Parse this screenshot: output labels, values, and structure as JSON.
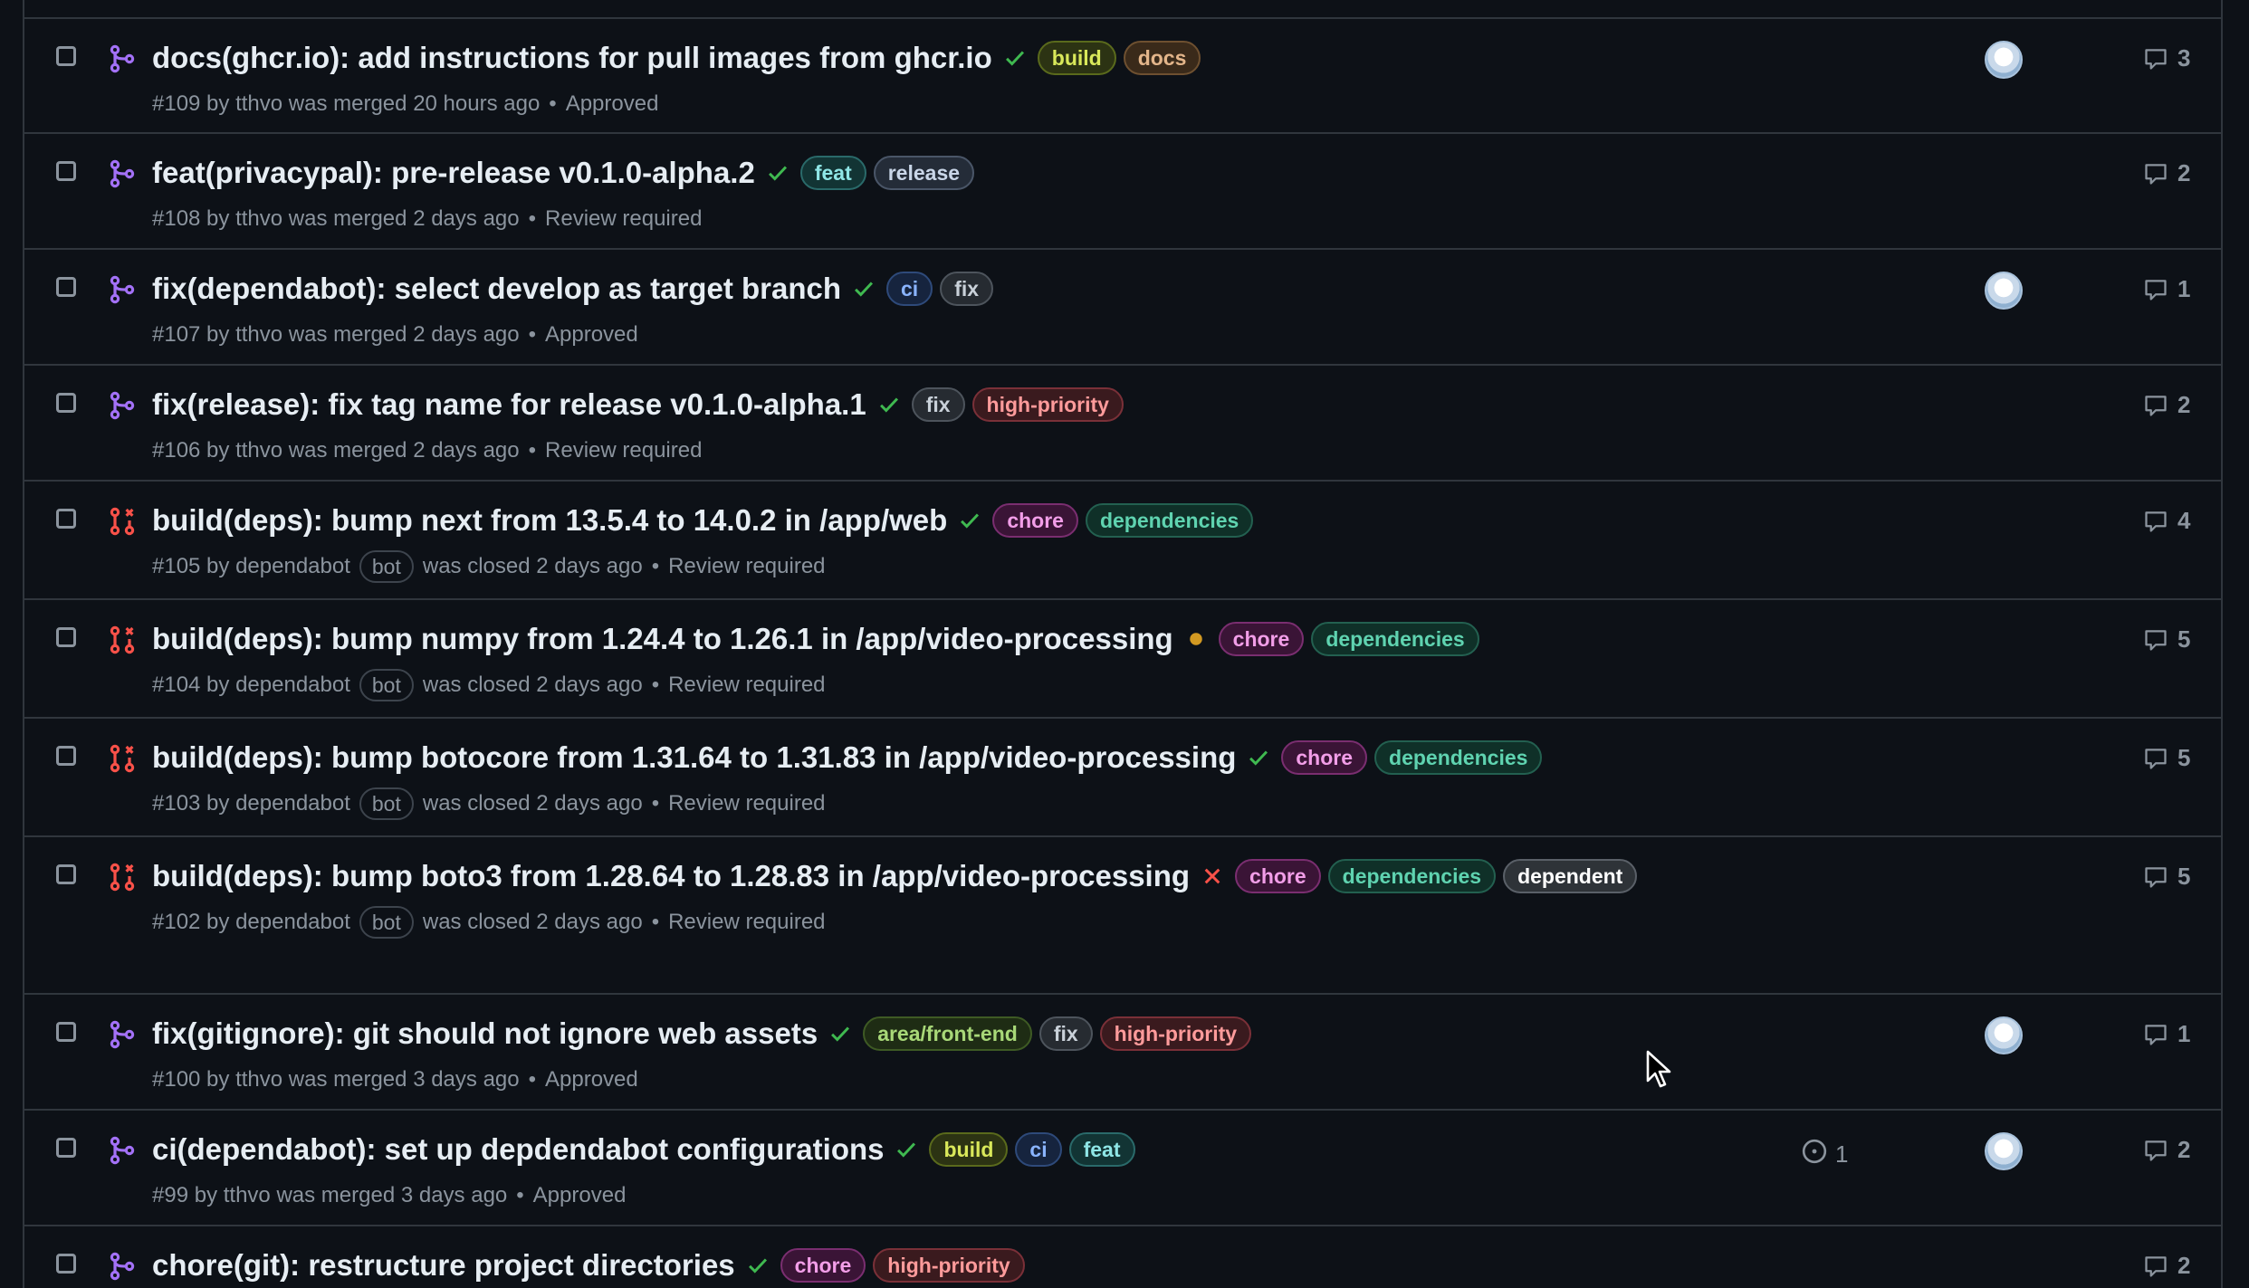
{
  "colors": {
    "background": "#0d1117",
    "border": "#30363d",
    "merged_icon": "#a371f7",
    "closed_icon": "#f85149",
    "check_success": "#3fb950",
    "check_failure": "#f85149",
    "check_pending": "#d29922",
    "muted_text": "#8b949e"
  },
  "labels": {
    "build": {
      "text": "build",
      "fg": "#d9e85a",
      "bg": "#2c3313",
      "border": "#5a6a1c"
    },
    "docs": {
      "text": "docs",
      "fg": "#e3b58a",
      "bg": "#3a2a1a",
      "border": "#6e5030"
    },
    "feat": {
      "text": "feat",
      "fg": "#8fe6e6",
      "bg": "#123434",
      "border": "#2a6a6a"
    },
    "release": {
      "text": "release",
      "fg": "#c9d6e8",
      "bg": "#242c38",
      "border": "#4a5668"
    },
    "ci": {
      "text": "ci",
      "fg": "#8ab4ff",
      "bg": "#16243e",
      "border": "#2e4a7a"
    },
    "fix": {
      "text": "fix",
      "fg": "#c9d1d9",
      "bg": "#262b31",
      "border": "#4d545c"
    },
    "high-priority": {
      "text": "high-priority",
      "fg": "#ff9b9b",
      "bg": "#3a1a1e",
      "border": "#7a3038"
    },
    "chore": {
      "text": "chore",
      "fg": "#f29ee8",
      "bg": "#3a1436",
      "border": "#7a2e70"
    },
    "dependencies": {
      "text": "dependencies",
      "fg": "#5fd3b0",
      "bg": "#0f3028",
      "border": "#236050"
    },
    "dependent": {
      "text": "dependent",
      "fg": "#ffffff",
      "bg": "#2e3338",
      "border": "#5a6068"
    },
    "area/front-end": {
      "text": "area/front-end",
      "fg": "#a8d878",
      "bg": "#1e2c14",
      "border": "#3e5a24"
    }
  },
  "pull_requests": [
    {
      "title": "docs(ghcr.io): add instructions for pull images from ghcr.io",
      "state": "merged",
      "check": "success",
      "labels": [
        "build",
        "docs"
      ],
      "number": "#109",
      "author": "tthvo",
      "bot": "",
      "action": "was merged",
      "time": "20 hours ago",
      "review": "Approved",
      "avatar": true,
      "tasks": "",
      "comments": "3"
    },
    {
      "title": "feat(privacypal): pre-release v0.1.0-alpha.2",
      "state": "merged",
      "check": "success",
      "labels": [
        "feat",
        "release"
      ],
      "number": "#108",
      "author": "tthvo",
      "bot": "",
      "action": "was merged",
      "time": "2 days ago",
      "review": "Review required",
      "avatar": false,
      "tasks": "",
      "comments": "2"
    },
    {
      "title": "fix(dependabot): select develop as target branch",
      "state": "merged",
      "check": "success",
      "labels": [
        "ci",
        "fix"
      ],
      "number": "#107",
      "author": "tthvo",
      "bot": "",
      "action": "was merged",
      "time": "2 days ago",
      "review": "Approved",
      "avatar": true,
      "tasks": "",
      "comments": "1"
    },
    {
      "title": "fix(release): fix tag name for release v0.1.0-alpha.1",
      "state": "merged",
      "check": "success",
      "labels": [
        "fix",
        "high-priority"
      ],
      "number": "#106",
      "author": "tthvo",
      "bot": "",
      "action": "was merged",
      "time": "2 days ago",
      "review": "Review required",
      "avatar": false,
      "tasks": "",
      "comments": "2"
    },
    {
      "title": "build(deps): bump next from 13.5.4 to 14.0.2 in /app/web",
      "state": "closed",
      "check": "success",
      "labels": [
        "chore",
        "dependencies"
      ],
      "number": "#105",
      "author": "dependabot",
      "bot": "bot",
      "action": "was closed",
      "time": "2 days ago",
      "review": "Review required",
      "avatar": false,
      "tasks": "",
      "comments": "4"
    },
    {
      "title": "build(deps): bump numpy from 1.24.4 to 1.26.1 in /app/video-processing",
      "state": "closed",
      "check": "pending",
      "labels": [
        "chore",
        "dependencies"
      ],
      "number": "#104",
      "author": "dependabot",
      "bot": "bot",
      "action": "was closed",
      "time": "2 days ago",
      "review": "Review required",
      "avatar": false,
      "tasks": "",
      "comments": "5"
    },
    {
      "title": "build(deps): bump botocore from 1.31.64 to 1.31.83 in /app/video-processing",
      "state": "closed",
      "check": "success",
      "labels": [
        "chore",
        "dependencies"
      ],
      "number": "#103",
      "author": "dependabot",
      "bot": "bot",
      "action": "was closed",
      "time": "2 days ago",
      "review": "Review required",
      "avatar": false,
      "tasks": "",
      "comments": "5"
    },
    {
      "title": "build(deps): bump boto3 from 1.28.64 to 1.28.83 in /app/video-processing",
      "state": "closed",
      "check": "failure",
      "labels": [
        "chore",
        "dependencies",
        "dependent"
      ],
      "number": "#102",
      "author": "dependabot",
      "bot": "bot",
      "action": "was closed",
      "time": "2 days ago",
      "review": "Review required",
      "avatar": false,
      "tasks": "",
      "comments": "5"
    },
    {
      "title": "fix(gitignore): git should not ignore web assets",
      "state": "merged",
      "check": "success",
      "labels": [
        "area/front-end",
        "fix",
        "high-priority"
      ],
      "number": "#100",
      "author": "tthvo",
      "bot": "",
      "action": "was merged",
      "time": "3 days ago",
      "review": "Approved",
      "avatar": true,
      "tasks": "",
      "comments": "1"
    },
    {
      "title": "ci(dependabot): set up depdendabot configurations",
      "state": "merged",
      "check": "success",
      "labels": [
        "build",
        "ci",
        "feat"
      ],
      "number": "#99",
      "author": "tthvo",
      "bot": "",
      "action": "was merged",
      "time": "3 days ago",
      "review": "Approved",
      "avatar": true,
      "tasks": "1",
      "comments": "2"
    },
    {
      "title": "chore(git): restructure project directories",
      "state": "merged",
      "check": "success",
      "labels": [
        "chore",
        "high-priority"
      ],
      "number": "",
      "author": "",
      "bot": "",
      "action": "",
      "time": "",
      "review": "",
      "avatar": false,
      "tasks": "",
      "comments": "2"
    }
  ],
  "cursor": {
    "visible": true
  }
}
